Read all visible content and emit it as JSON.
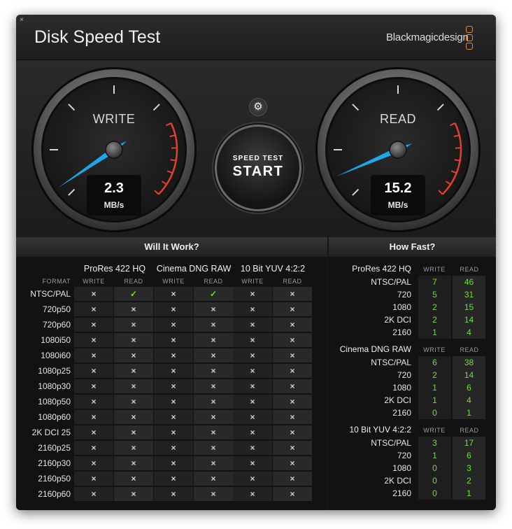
{
  "window": {
    "title": "Disk Speed Test",
    "brand": "Blackmagicdesign",
    "close_glyph": "×"
  },
  "gauges": {
    "write": {
      "label": "WRITE",
      "value": "2.3",
      "unit": "MB/s",
      "fraction": 0.04
    },
    "read": {
      "label": "READ",
      "value": "15.2",
      "unit": "MB/s",
      "fraction": 0.08
    }
  },
  "controls": {
    "settings_icon": "gear-icon",
    "settings_glyph": "⚙",
    "start_small": "SPEED TEST",
    "start_big": "START"
  },
  "colors": {
    "needle": "#1ea7e8",
    "redzone": "#e0402e",
    "ok": "#6ee02d",
    "accent": "#e2902c"
  },
  "will_it_work": {
    "title": "Will It Work?",
    "format_header": "FORMAT",
    "write_header": "WRITE",
    "read_header": "READ",
    "yes_glyph": "✓",
    "no_glyph": "×",
    "codecs": [
      "ProRes 422 HQ",
      "Cinema DNG RAW",
      "10 Bit YUV 4:2:2"
    ],
    "rows": [
      {
        "format": "NTSC/PAL",
        "results": [
          false,
          true,
          false,
          true,
          false,
          false
        ]
      },
      {
        "format": "720p50",
        "results": [
          false,
          false,
          false,
          false,
          false,
          false
        ]
      },
      {
        "format": "720p60",
        "results": [
          false,
          false,
          false,
          false,
          false,
          false
        ]
      },
      {
        "format": "1080i50",
        "results": [
          false,
          false,
          false,
          false,
          false,
          false
        ]
      },
      {
        "format": "1080i60",
        "results": [
          false,
          false,
          false,
          false,
          false,
          false
        ]
      },
      {
        "format": "1080p25",
        "results": [
          false,
          false,
          false,
          false,
          false,
          false
        ]
      },
      {
        "format": "1080p30",
        "results": [
          false,
          false,
          false,
          false,
          false,
          false
        ]
      },
      {
        "format": "1080p50",
        "results": [
          false,
          false,
          false,
          false,
          false,
          false
        ]
      },
      {
        "format": "1080p60",
        "results": [
          false,
          false,
          false,
          false,
          false,
          false
        ]
      },
      {
        "format": "2K DCI 25",
        "results": [
          false,
          false,
          false,
          false,
          false,
          false
        ]
      },
      {
        "format": "2160p25",
        "results": [
          false,
          false,
          false,
          false,
          false,
          false
        ]
      },
      {
        "format": "2160p30",
        "results": [
          false,
          false,
          false,
          false,
          false,
          false
        ]
      },
      {
        "format": "2160p50",
        "results": [
          false,
          false,
          false,
          false,
          false,
          false
        ]
      },
      {
        "format": "2160p60",
        "results": [
          false,
          false,
          false,
          false,
          false,
          false
        ]
      }
    ]
  },
  "how_fast": {
    "title": "How Fast?",
    "write_header": "WRITE",
    "read_header": "READ",
    "groups": [
      {
        "codec": "ProRes 422 HQ",
        "rows": [
          {
            "format": "NTSC/PAL",
            "write": "7",
            "read": "46"
          },
          {
            "format": "720",
            "write": "5",
            "read": "31"
          },
          {
            "format": "1080",
            "write": "2",
            "read": "15"
          },
          {
            "format": "2K DCI",
            "write": "2",
            "read": "14"
          },
          {
            "format": "2160",
            "write": "1",
            "read": "4"
          }
        ]
      },
      {
        "codec": "Cinema DNG RAW",
        "rows": [
          {
            "format": "NTSC/PAL",
            "write": "6",
            "read": "38"
          },
          {
            "format": "720",
            "write": "2",
            "read": "14"
          },
          {
            "format": "1080",
            "write": "1",
            "read": "6"
          },
          {
            "format": "2K DCI",
            "write": "1",
            "read": "4"
          },
          {
            "format": "2160",
            "write": "0",
            "read": "1"
          }
        ]
      },
      {
        "codec": "10 Bit YUV 4:2:2",
        "rows": [
          {
            "format": "NTSC/PAL",
            "write": "3",
            "read": "17"
          },
          {
            "format": "720",
            "write": "1",
            "read": "6"
          },
          {
            "format": "1080",
            "write": "0",
            "read": "3"
          },
          {
            "format": "2K DCI",
            "write": "0",
            "read": "2"
          },
          {
            "format": "2160",
            "write": "0",
            "read": "1"
          }
        ]
      }
    ]
  }
}
